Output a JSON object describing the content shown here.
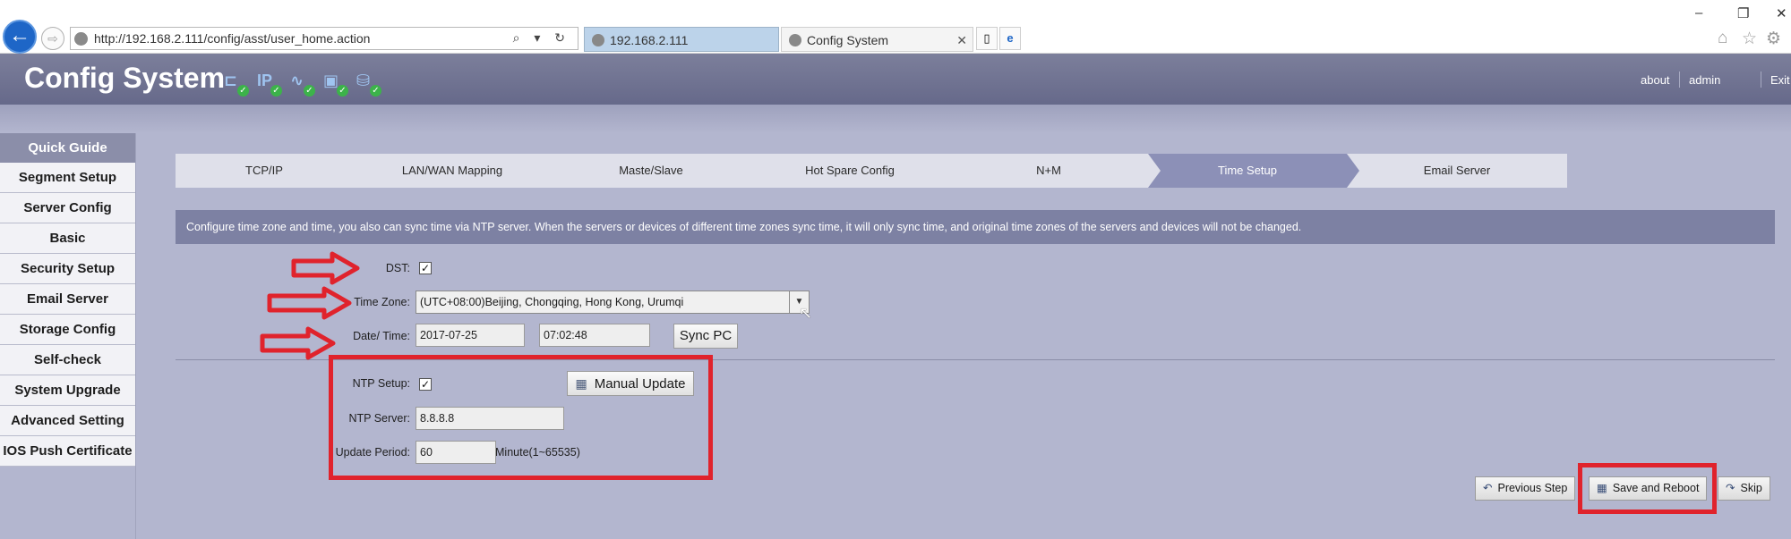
{
  "browser": {
    "url": "http://192.168.2.111/config/asst/user_home.action",
    "address_tools": "⌕ ▾ ↻",
    "tabs": [
      {
        "label": "192.168.2.111"
      },
      {
        "label": "Config System"
      }
    ],
    "tab_close": "✕",
    "back_glyph": "←",
    "forward_glyph": "⇨",
    "window_controls": [
      "–",
      "❐",
      "✕"
    ],
    "right_icons": [
      "⌂",
      "☆",
      "⚙"
    ]
  },
  "app": {
    "title": "Config System",
    "header_icons": [
      "network-icon",
      "ip-icon",
      "wave-icon",
      "monitor-icon",
      "storage-icon"
    ],
    "header_links": [
      "about",
      "admin",
      "Exit"
    ]
  },
  "sidebar": {
    "header": "Quick Guide",
    "items": [
      {
        "label": "Segment Setup"
      },
      {
        "label": "Server Config"
      },
      {
        "label": "Basic"
      },
      {
        "label": "Security Setup"
      },
      {
        "label": "Email Server"
      },
      {
        "label": "Storage Config"
      },
      {
        "label": "Self-check"
      },
      {
        "label": "System Upgrade"
      },
      {
        "label": "Advanced Setting"
      },
      {
        "label": "IOS Push Certificate"
      }
    ]
  },
  "steps": [
    {
      "label": "TCP/IP",
      "active": false
    },
    {
      "label": "LAN/WAN Mapping",
      "active": false
    },
    {
      "label": "Maste/Slave",
      "active": false
    },
    {
      "label": "Hot Spare Config",
      "active": false
    },
    {
      "label": "N+M",
      "active": false
    },
    {
      "label": "Time Setup",
      "active": true
    },
    {
      "label": "Email Server",
      "active": false
    }
  ],
  "info_text": "Configure time zone and time, you also can sync time via NTP server. When the servers or devices of different time zones sync time, it will only sync time, and original time zones of the servers and devices will not be changed.",
  "form": {
    "dst_label": "DST:",
    "dst_checked": true,
    "timezone_label": "Time Zone:",
    "timezone_value": "(UTC+08:00)Beijing, Chongqing, Hong Kong, Urumqi",
    "datetime_label": "Date/ Time:",
    "date_value": "2017-07-25",
    "time_value": "07:02:48",
    "sync_pc_label": "Sync PC",
    "ntp_setup_label": "NTP Setup:",
    "ntp_checked": true,
    "manual_update_label": "Manual Update",
    "ntp_server_label": "NTP Server:",
    "ntp_server_value": "8.8.8.8",
    "update_period_label": "Update Period:",
    "update_period_value": "60",
    "update_period_unit": "Minute(1~65535)"
  },
  "footer": {
    "previous_label": "Previous Step",
    "save_reboot_label": "Save and Reboot",
    "skip_label": "Skip"
  },
  "colors": {
    "annotation_red": "#e0232c",
    "active_step": "#8c90b7",
    "background": "#b3b6cf"
  }
}
